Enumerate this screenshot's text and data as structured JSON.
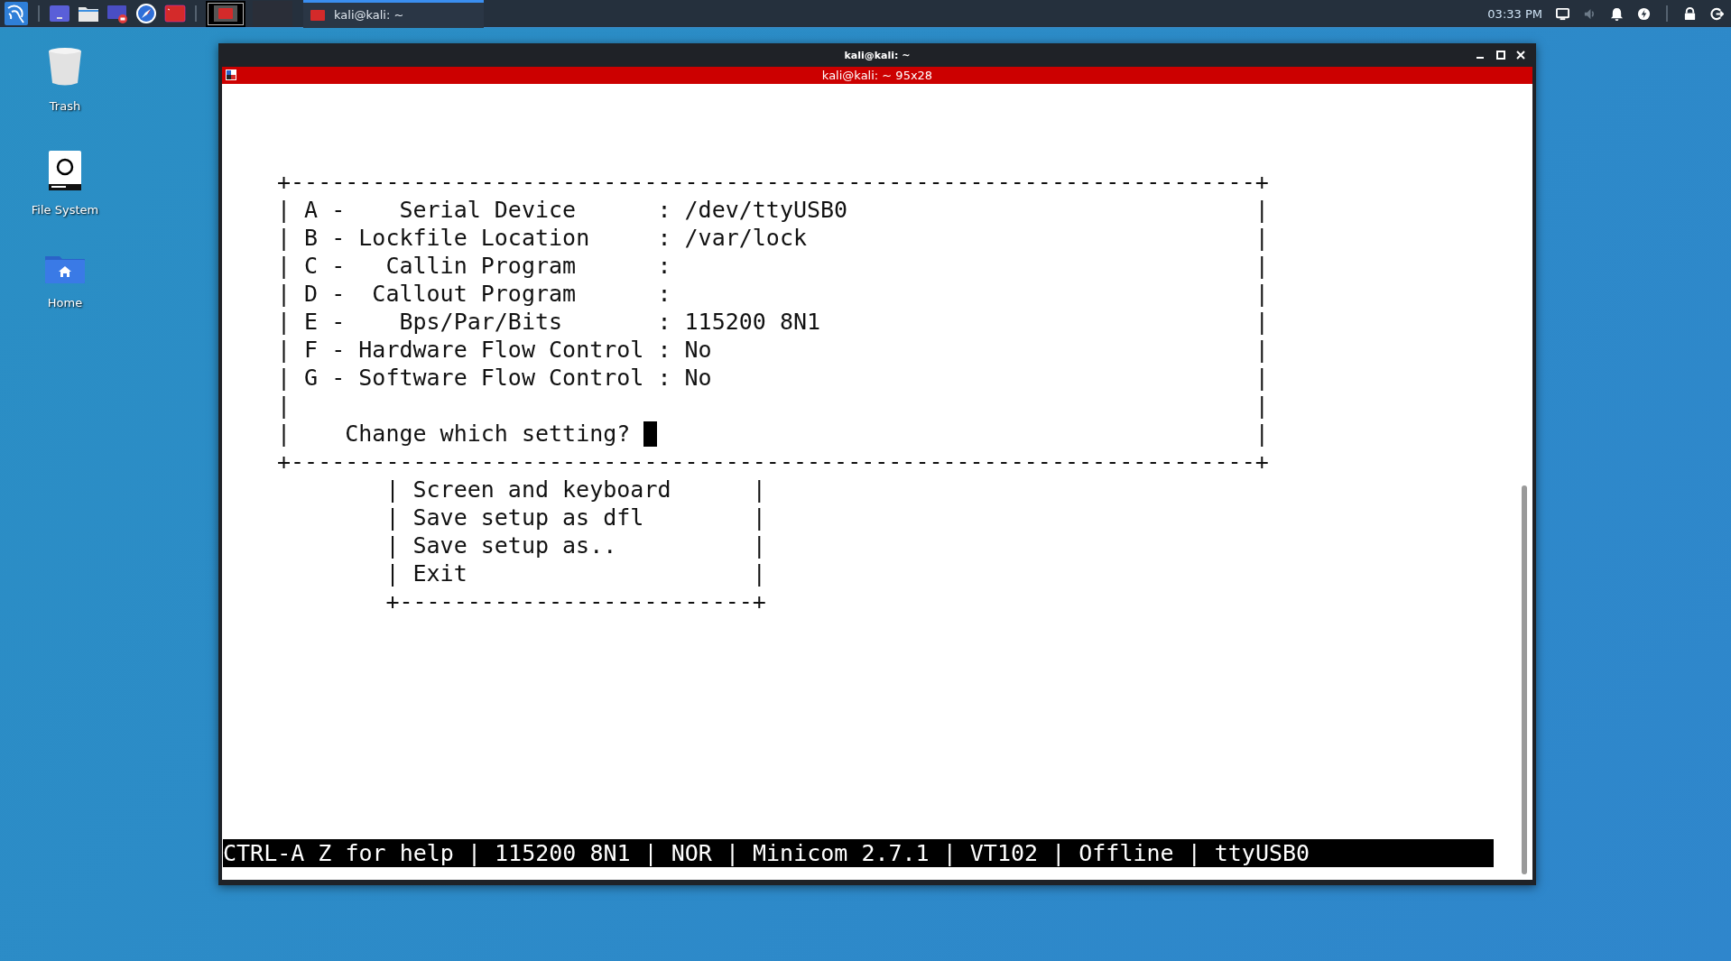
{
  "taskbar": {
    "workspaces": [
      {
        "selected": true
      },
      {
        "selected": false
      }
    ],
    "task": {
      "title": "kali@kali: ~",
      "selected": true
    },
    "clock": "03:33 PM"
  },
  "desktop_icons": [
    {
      "label": "Trash",
      "kind": "trash"
    },
    {
      "label": "File System",
      "kind": "drive"
    },
    {
      "label": "Home",
      "kind": "home"
    }
  ],
  "window": {
    "title": "kali@kali: ~",
    "tab_title": "kali@kali: ~ 95x28"
  },
  "terminal": {
    "setup_box": {
      "border_top": "+-----------------------------------------------------------------------+",
      "rows": [
        {
          "kind": "line",
          "text": "| A -    Serial Device      : /dev/ttyUSB0",
          "end": "|"
        },
        {
          "kind": "line",
          "text": "| B - Lockfile Location     : /var/lock",
          "end": "|"
        },
        {
          "kind": "line",
          "text": "| C -   Callin Program      :",
          "end": "|"
        },
        {
          "kind": "line",
          "text": "| D -  Callout Program      :",
          "end": "|"
        },
        {
          "kind": "line",
          "text": "| E -    Bps/Par/Bits       : 115200 8N1",
          "end": "|"
        },
        {
          "kind": "line",
          "text": "| F - Hardware Flow Control : No",
          "end": "|"
        },
        {
          "kind": "line",
          "text": "| G - Software Flow Control : No",
          "end": "|"
        },
        {
          "kind": "line",
          "text": "|",
          "end": "|"
        },
        {
          "kind": "prompt",
          "text": "|    Change which setting? ",
          "end": "|"
        }
      ],
      "border_bottom": "+-----------------------------------------------------------------------+"
    },
    "menu": {
      "rows": [
        {
          "text": "| Screen and keyboard",
          "end": "|"
        },
        {
          "text": "| Save setup as dfl",
          "end": "|"
        },
        {
          "text": "| Save setup as..",
          "end": "|"
        },
        {
          "text": "| Exit",
          "end": "|"
        }
      ],
      "border_bottom": "+--------------------------+"
    },
    "status_line": "CTRL-A Z for help | 115200 8N1 | NOR | Minicom 2.7.1 | VT102 | Offline | ttyUSB0"
  }
}
